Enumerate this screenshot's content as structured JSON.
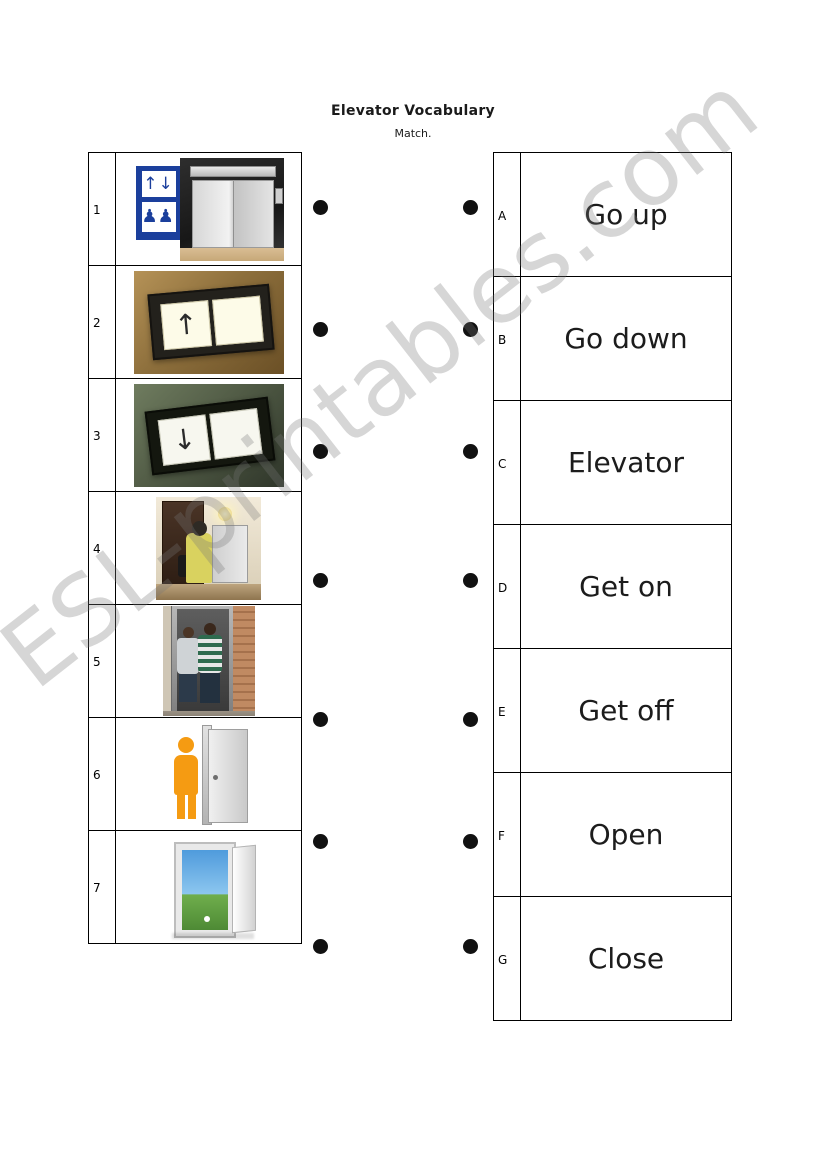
{
  "worksheet": {
    "title": "Elevator Vocabulary",
    "instruction": "Match."
  },
  "left_column": {
    "items": [
      {
        "number": "1",
        "picture": "elevator-sign-and-doors"
      },
      {
        "number": "2",
        "picture": "up-arrow-button-panel"
      },
      {
        "number": "3",
        "picture": "down-arrow-button-panel"
      },
      {
        "number": "4",
        "picture": "person-entering-elevator"
      },
      {
        "number": "5",
        "picture": "people-exiting-elevator"
      },
      {
        "number": "6",
        "picture": "figure-beside-open-door"
      },
      {
        "number": "7",
        "picture": "open-door-to-field"
      }
    ]
  },
  "right_column": {
    "items": [
      {
        "letter": "A",
        "word": "Go up"
      },
      {
        "letter": "B",
        "word": "Go down"
      },
      {
        "letter": "C",
        "word": "Elevator"
      },
      {
        "letter": "D",
        "word": "Get on"
      },
      {
        "letter": "E",
        "word": "Get off"
      },
      {
        "letter": "F",
        "word": "Open"
      },
      {
        "letter": "G",
        "word": "Close"
      }
    ]
  },
  "watermark": {
    "text": "ESL-printables.com"
  },
  "icons": {
    "up_arrow": "↑",
    "down_arrow": "↓",
    "up_down_arrows": "↑↓",
    "people": "AA"
  }
}
